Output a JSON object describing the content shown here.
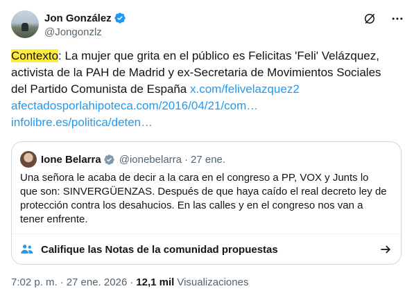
{
  "author": {
    "name": "Jon González",
    "handle": "@Jongonzlz"
  },
  "tweet": {
    "highlight": "Contexto",
    "text_after_highlight": ": La mujer que grita en el público es Felicitas 'Feli' Velázquez, activista de la PAH de Madrid y ex-Secretaria de Movimientos Sociales del Partido Comunista de España ",
    "link1": "x.com/felivelazquez2",
    "link2": "afectadosporlahipoteca.com/2016/04/21/com…",
    "link3": "infolibre.es/politica/deten…"
  },
  "quoted": {
    "name": "Ione Belarra",
    "handle": "@ionebelarra",
    "date": "27 ene.",
    "text": "Una señora le acaba de decir a la cara en el congreso a PP, VOX y Junts lo que son: SINVERGÜENZAS. Después de que haya caído el real decreto ley de protección contra los desahucios. En las calles y en el congreso nos van a tener enfrente."
  },
  "community": {
    "label": "Califique las Notas de la comunidad propuestas"
  },
  "footer": {
    "time": "7:02 p. m.",
    "date": "27 ene. 2026",
    "separator": "·",
    "views_count": "12,1 mil",
    "views_label": "Visualizaciones"
  },
  "colors": {
    "accent": "#1d9bf0",
    "highlight": "#ffeb3b",
    "muted": "#536471"
  }
}
